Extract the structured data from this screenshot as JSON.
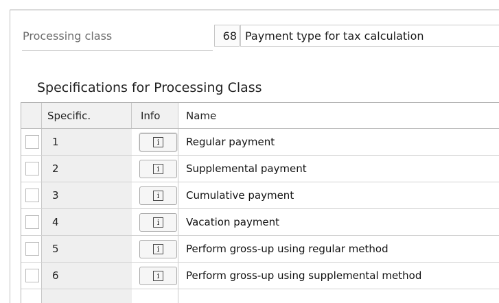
{
  "header": {
    "processing_class_label": "Processing class",
    "processing_class_code": "68",
    "processing_class_description": "Payment type for tax calculation"
  },
  "section": {
    "title": "Specifications for Processing Class"
  },
  "table": {
    "columns": {
      "specific": "Specific.",
      "info": "Info",
      "name": "Name"
    },
    "info_icon": "info-icon",
    "rows": [
      {
        "specific": "1",
        "name": "Regular payment"
      },
      {
        "specific": "2",
        "name": "Supplemental payment"
      },
      {
        "specific": "3",
        "name": "Cumulative payment"
      },
      {
        "specific": "4",
        "name": "Vacation payment"
      },
      {
        "specific": "5",
        "name": "Perform gross-up using regular method"
      },
      {
        "specific": "6",
        "name": "Perform gross-up using supplemental method"
      }
    ]
  },
  "colors": {
    "header_bg": "#f1f1f1",
    "spec_cell_bg": "#efefef",
    "border": "#b4b4b4"
  }
}
